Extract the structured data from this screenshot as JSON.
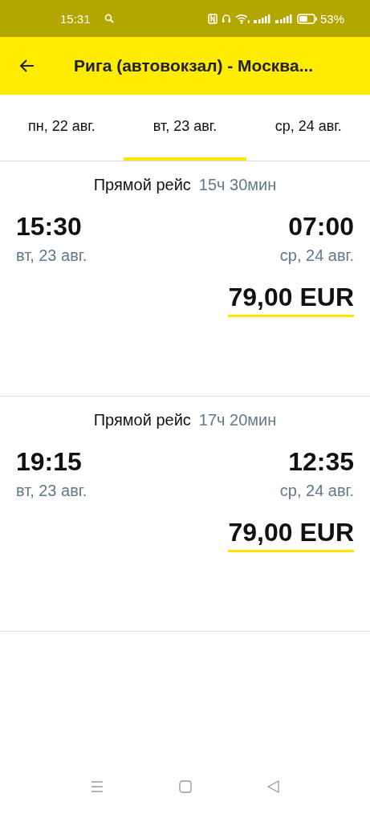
{
  "status_bar": {
    "time": "15:31",
    "battery": "53%"
  },
  "header": {
    "title": "Рига (автовокзал) - Москва..."
  },
  "tabs": [
    {
      "label": "пн, 22 авг.",
      "selected": false
    },
    {
      "label": "вт, 23 авг.",
      "selected": true
    },
    {
      "label": "ср, 24 авг.",
      "selected": false
    }
  ],
  "trips": [
    {
      "type": "Прямой рейс",
      "duration": "15ч 30мин",
      "depart_time": "15:30",
      "depart_date": "вт, 23 авг.",
      "arrive_time": "07:00",
      "arrive_date": "ср, 24 авг.",
      "price": "79,00 EUR"
    },
    {
      "type": "Прямой рейс",
      "duration": "17ч 20мин",
      "depart_time": "19:15",
      "depart_date": "вт, 23 авг.",
      "arrive_time": "12:35",
      "arrive_date": "ср, 24 авг.",
      "price": "79,00 EUR"
    }
  ]
}
